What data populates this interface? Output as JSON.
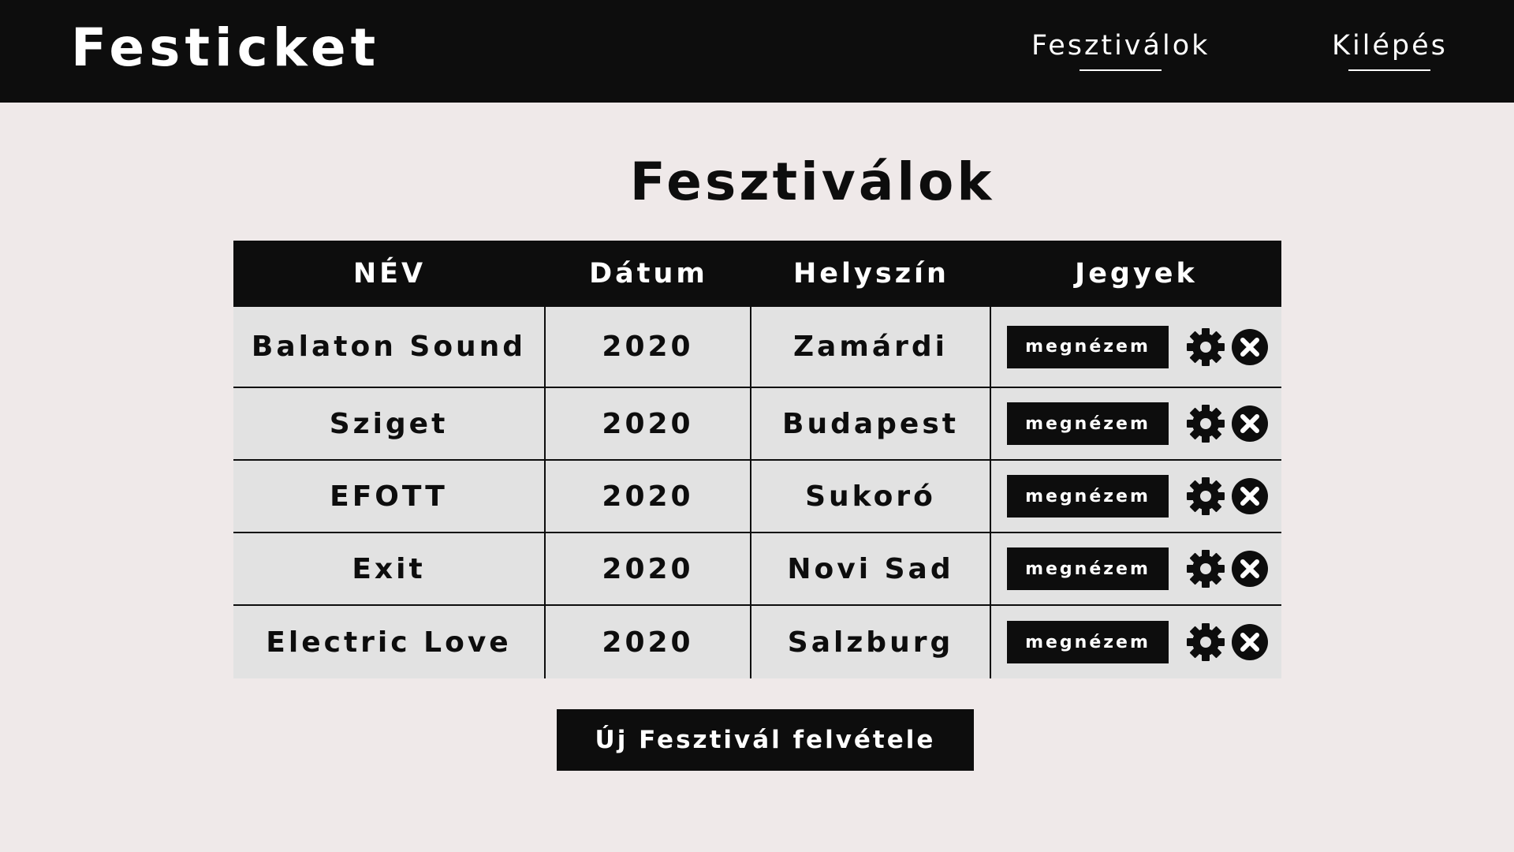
{
  "header": {
    "brand": "Festicket",
    "nav": [
      {
        "label": "Fesztiválok"
      },
      {
        "label": "Kilépés"
      }
    ]
  },
  "main": {
    "title": "Fesztiválok",
    "table": {
      "columns": [
        "NÉV",
        "Dátum",
        "Helyszín",
        "Jegyek"
      ],
      "rows": [
        {
          "name": "Balaton Sound",
          "date": "2020",
          "location": "Zamárdi",
          "action": "megnézem"
        },
        {
          "name": "Sziget",
          "date": "2020",
          "location": "Budapest",
          "action": "megnézem"
        },
        {
          "name": "EFOTT",
          "date": "2020",
          "location": "Sukoró",
          "action": "megnézem"
        },
        {
          "name": "Exit",
          "date": "2020",
          "location": "Novi Sad",
          "action": "megnézem"
        },
        {
          "name": "Electric Love",
          "date": "2020",
          "location": "Salzburg",
          "action": "megnézem"
        }
      ],
      "row_icons": [
        "gear-icon",
        "close-circle-icon"
      ]
    },
    "add_button": "Új Fesztivál felvétele"
  },
  "colors": {
    "background": "#efe9e9",
    "dark": "#0d0d0d",
    "row_background": "#e2e2e2",
    "text_light": "#ffffff"
  }
}
